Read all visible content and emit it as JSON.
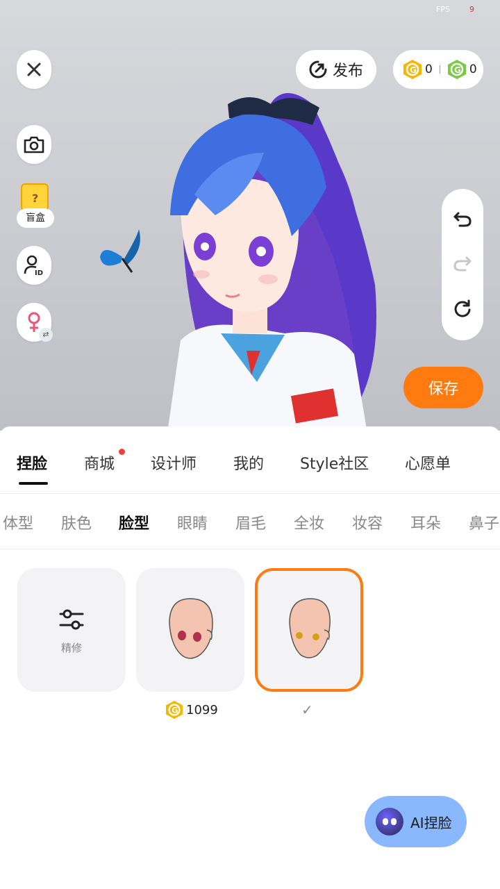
{
  "fps": {
    "label": "FPS",
    "value": "9"
  },
  "top": {
    "publish_label": "发布",
    "coins_gold": "0",
    "coins_green": "0"
  },
  "left_tools": {
    "blindbox_label": "盲盒"
  },
  "save_label": "保存",
  "main_tabs": [
    {
      "label": "捏脸",
      "active": true
    },
    {
      "label": "商城",
      "badge": true
    },
    {
      "label": "设计师"
    },
    {
      "label": "我的"
    },
    {
      "label": "Style社区"
    },
    {
      "label": "心愿单"
    }
  ],
  "sub_tabs": [
    {
      "label": "体型"
    },
    {
      "label": "肤色"
    },
    {
      "label": "脸型",
      "active": true
    },
    {
      "label": "眼睛"
    },
    {
      "label": "眉毛"
    },
    {
      "label": "全妆"
    },
    {
      "label": "妆容"
    },
    {
      "label": "耳朵"
    },
    {
      "label": "鼻子"
    }
  ],
  "items": {
    "refine_label": "精修",
    "face1_price": "1099",
    "face2_selected": true
  },
  "ai_button_label": "AI捏脸",
  "colors": {
    "accent": "#ff7a0f",
    "gold_coin": "#f5b700",
    "green_coin": "#7ac943",
    "ai_button": "#8ab8ff"
  }
}
